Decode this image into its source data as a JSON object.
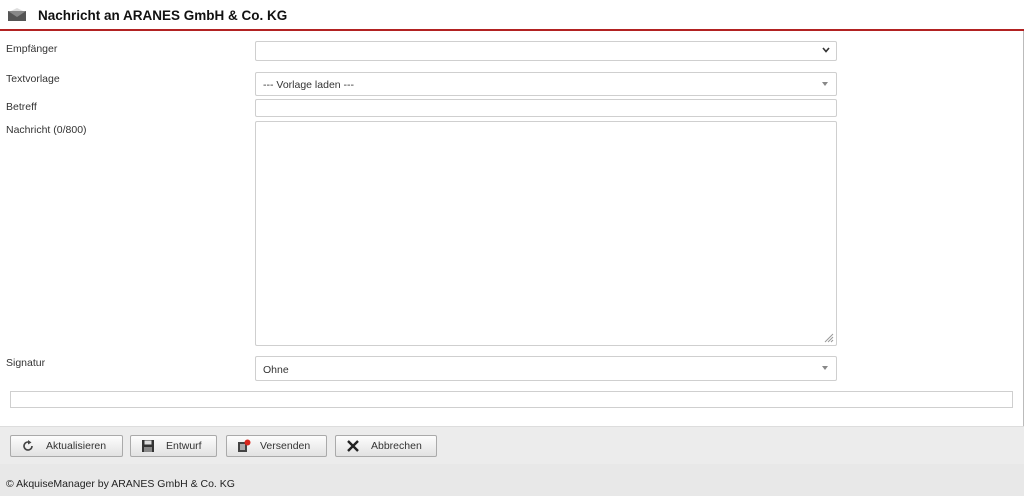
{
  "window": {
    "title": "Nachricht an ARANES GmbH & Co. KG"
  },
  "form": {
    "recipient": {
      "label": "Empfänger",
      "value": ""
    },
    "template": {
      "label": "Textvorlage",
      "value": "--- Vorlage laden ---"
    },
    "subject": {
      "label": "Betreff",
      "value": ""
    },
    "message": {
      "label": "Nachricht (0/800)",
      "value": ""
    },
    "signature": {
      "label": "Signatur",
      "value": "Ohne"
    }
  },
  "toolbar": {
    "refresh_label": "Aktualisieren",
    "draft_label": "Entwurf",
    "send_label": "Versenden",
    "cancel_label": "Abbrechen"
  },
  "footer": {
    "text": "© AkquiseManager by ARANES GmbH & Co. KG"
  },
  "colors": {
    "accent": "#b22222",
    "toolbar_bg": "#ececec",
    "border": "#cfcfcf"
  },
  "icons": {
    "title": "envelope-icon",
    "refresh": "refresh-icon",
    "draft": "floppy-disk-icon",
    "send": "send-icon",
    "cancel": "close-icon"
  }
}
